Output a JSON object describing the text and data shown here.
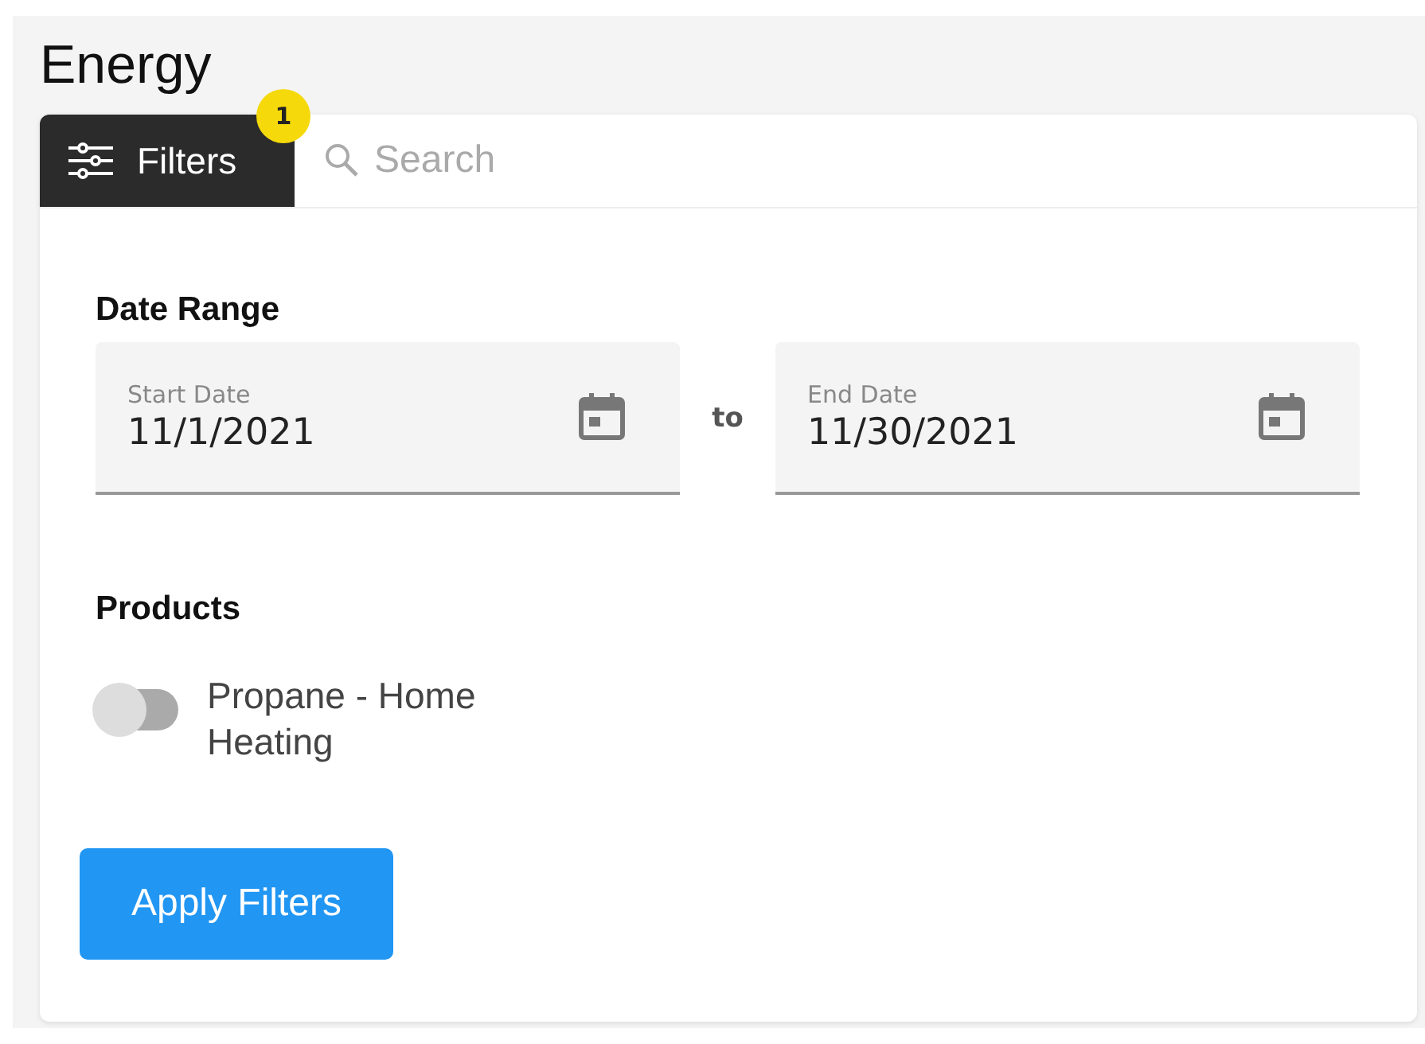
{
  "page": {
    "title": "Energy"
  },
  "filters_tab": {
    "label": "Filters",
    "badge": "1"
  },
  "search": {
    "placeholder": "Search"
  },
  "date_range": {
    "heading": "Date Range",
    "connector": "to",
    "fields": [
      {
        "label": "Start Date",
        "value": "11/1/2021"
      },
      {
        "label": "End Date",
        "value": "11/30/2021"
      }
    ]
  },
  "products": {
    "heading": "Products",
    "items": [
      {
        "label": "Propane - Home Heating",
        "on": false
      }
    ]
  },
  "apply_button": "Apply Filters"
}
